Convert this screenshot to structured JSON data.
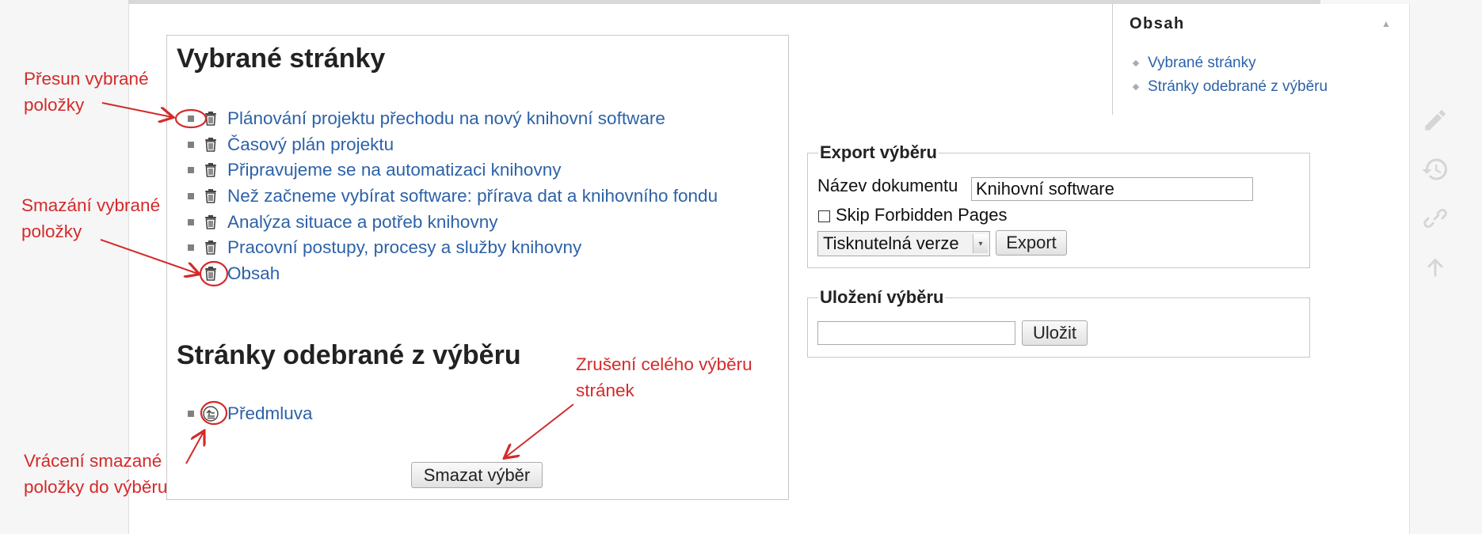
{
  "selected": {
    "heading": "Vybrané stránky",
    "items": [
      {
        "label": "Plánování projektu přechodu na nový knihovní software",
        "movable": true
      },
      {
        "label": "Časový plán projektu",
        "movable": true
      },
      {
        "label": "Připravujeme se na automatizaci knihovny",
        "movable": true
      },
      {
        "label": "Než začneme vybírat software: přírava dat a knihovního fondu",
        "movable": true
      },
      {
        "label": "Analýza situace a potřeb knihovny",
        "movable": true
      },
      {
        "label": "Pracovní postupy, procesy a služby knihovny",
        "movable": true
      },
      {
        "label": "Obsah",
        "movable": false
      }
    ]
  },
  "removed": {
    "heading": "Stránky odebrané z výběru",
    "items": [
      {
        "label": "Předmluva"
      }
    ]
  },
  "clear_button": "Smazat výběr",
  "toc": {
    "title": "Obsah",
    "toggle": "▲",
    "items": [
      "Vybrané stránky",
      "Stránky odebrané z výběru"
    ]
  },
  "export": {
    "legend": "Export výběru",
    "name_label": "Název dokumentu",
    "name_value": "Knihovní software",
    "checkbox_label": "Skip Forbidden Pages",
    "checkbox_checked": false,
    "format_selected": "Tisknutelná verze",
    "export_button": "Export"
  },
  "save": {
    "legend": "Uložení výběru",
    "name_value": "",
    "save_button": "Uložit"
  },
  "side_tools": [
    "pencil-icon",
    "history-icon",
    "link-icon",
    "arrow-up-icon"
  ],
  "annotations": {
    "move": [
      "Přesun vybrané",
      "položky"
    ],
    "delete": [
      "Smazání vybrané",
      "položky"
    ],
    "restore": [
      "Vrácení smazané",
      "položky do výběru"
    ],
    "clear": [
      "Zrušení celého výběru",
      "stránek"
    ]
  },
  "colors": {
    "link": "#2d62a8",
    "annotation": "#d42a2a",
    "border": "#c8c8c8"
  }
}
